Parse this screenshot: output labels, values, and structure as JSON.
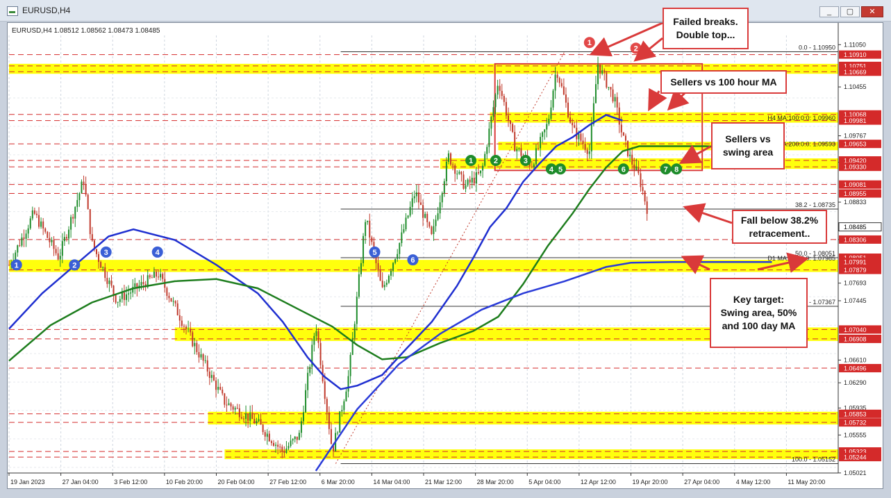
{
  "window": {
    "title": "EURUSD,H4",
    "min_label": "_",
    "max_label": "▢",
    "close_label": "✕"
  },
  "colors": {
    "bull": "#1e8c2b",
    "bear": "#c0392b",
    "ma100h": "#1f2fd0",
    "ma200h": "#1d7d1d",
    "ma100d": "#2a3bd8",
    "zone": "#ffff00",
    "levelLine": "#d42a2a",
    "tag": "#d42a2a",
    "greenMarker": "#1e8c2b",
    "blueMarker": "#3a5fd6",
    "redMarker": "#e24848",
    "annotation": "#d93a3a"
  },
  "chart_data": {
    "type": "candlestick",
    "symbol": "EURUSD",
    "timeframe": "H4",
    "info_line": "EURUSD,H4  1.08512 1.08562 1.08473 1.08485",
    "ylim": [
      1.0502,
      1.1118
    ],
    "current_price": "1.08485",
    "y_tick_labels": [
      "1.11050",
      "1.10455",
      "1.09767",
      "1.09395",
      "1.08833",
      "1.08306",
      "1.07693",
      "1.07445",
      "1.06610",
      "1.06290",
      "1.05935",
      "1.05555",
      "1.05021"
    ],
    "x_tick_labels": [
      "19 Jan 2023",
      "27 Jan 04:00",
      "3 Feb 12:00",
      "10 Feb 20:00",
      "20 Feb 04:00",
      "27 Feb 12:00",
      "6 Mar 20:00",
      "14 Mar 04:00",
      "21 Mar 12:00",
      "28 Mar 20:00",
      "5 Apr 04:00",
      "12 Apr 12:00",
      "19 Apr 20:00",
      "27 Apr 04:00",
      "4 May 12:00",
      "11 May 20:00"
    ],
    "price_tags": [
      {
        "label": "1.10910",
        "value": 1.1091
      },
      {
        "label": "1.10751",
        "value": 1.10751
      },
      {
        "label": "1.10669",
        "value": 1.10669
      },
      {
        "label": "1.10068",
        "value": 1.10068
      },
      {
        "label": "1.09981",
        "value": 1.09981
      },
      {
        "label": "1.09653",
        "value": 1.09653
      },
      {
        "label": "1.09420",
        "value": 1.0942
      },
      {
        "label": "1.09330",
        "value": 1.0933
      },
      {
        "label": "1.09081",
        "value": 1.09081
      },
      {
        "label": "1.08955",
        "value": 1.08955
      },
      {
        "label": "1.08485",
        "value": 1.08485
      },
      {
        "label": "1.08306",
        "value": 1.08306
      },
      {
        "label": "1.08051",
        "value": 1.08051
      },
      {
        "label": "1.07991",
        "value": 1.07991
      },
      {
        "label": "1.07879",
        "value": 1.07879
      },
      {
        "label": "1.07040",
        "value": 1.0704
      },
      {
        "label": "1.06908",
        "value": 1.06908
      },
      {
        "label": "1.06496",
        "value": 1.06496
      },
      {
        "label": "1.05853",
        "value": 1.05853
      },
      {
        "label": "1.05732",
        "value": 1.05732
      },
      {
        "label": "1.05323",
        "value": 1.05323
      },
      {
        "label": "1.05244",
        "value": 1.05244
      }
    ],
    "fib_levels": [
      {
        "label": "0.0 - 1.10950",
        "value": 1.1095
      },
      {
        "label": "38.2 - 1.08735",
        "value": 1.08735
      },
      {
        "label": "50.0 - 1.08051",
        "value": 1.08051
      },
      {
        "label": "61.8 - 1.07367",
        "value": 1.07367
      },
      {
        "label": "100.0 - 1.05152",
        "value": 1.05152
      }
    ],
    "ma_labels": [
      {
        "label": "H4 MA:100:0:0: 1.09960",
        "value": 1.0996
      },
      {
        "label": "H4 MA:200:0:0: 1.09593",
        "value": 1.09593
      },
      {
        "label": "D1 MA:100:0:0: 1.07985",
        "value": 1.07985
      }
    ],
    "zones": [
      {
        "top": 1.10751,
        "bottom": 1.10669
      },
      {
        "top": 1.10068,
        "bottom": 1.09981
      },
      {
        "top": 1.09653,
        "bottom": 1.09593
      },
      {
        "top": 1.0942,
        "bottom": 1.0933
      },
      {
        "top": 1.07991,
        "bottom": 1.07879
      },
      {
        "top": 1.0704,
        "bottom": 1.06908
      },
      {
        "top": 1.05853,
        "bottom": 1.05732
      },
      {
        "top": 1.05323,
        "bottom": 1.05244
      }
    ],
    "dashed_levels": [
      1.1091,
      1.10751,
      1.10669,
      1.10068,
      1.09981,
      1.09653,
      1.0942,
      1.0933,
      1.09081,
      1.08955,
      1.08306,
      1.07879,
      1.0704,
      1.06908,
      1.06496,
      1.05853,
      1.05732,
      1.05323,
      1.05244
    ],
    "ma100_h4": [
      [
        0,
        1.0705
      ],
      [
        0.04,
        1.0755
      ],
      [
        0.08,
        1.0795
      ],
      [
        0.12,
        1.0835
      ],
      [
        0.15,
        1.0845
      ],
      [
        0.2,
        1.083
      ],
      [
        0.25,
        1.0795
      ],
      [
        0.3,
        1.0755
      ],
      [
        0.33,
        1.0715
      ],
      [
        0.36,
        1.0665
      ],
      [
        0.38,
        1.0638
      ],
      [
        0.4,
        1.062
      ],
      [
        0.42,
        1.0625
      ],
      [
        0.45,
        1.064
      ],
      [
        0.48,
        1.0678
      ],
      [
        0.51,
        1.0715
      ],
      [
        0.54,
        1.0765
      ],
      [
        0.56,
        1.0805
      ],
      [
        0.58,
        1.0848
      ],
      [
        0.6,
        1.0875
      ],
      [
        0.62,
        1.0912
      ],
      [
        0.64,
        1.0938
      ],
      [
        0.66,
        1.0962
      ],
      [
        0.68,
        1.0975
      ],
      [
        0.7,
        1.0992
      ],
      [
        0.72,
        1.1006
      ],
      [
        0.73,
        1.1002
      ],
      [
        0.74,
        1.0998
      ]
    ],
    "ma200_h4": [
      [
        0,
        1.066
      ],
      [
        0.05,
        1.071
      ],
      [
        0.1,
        1.0742
      ],
      [
        0.15,
        1.0762
      ],
      [
        0.2,
        1.0772
      ],
      [
        0.25,
        1.0775
      ],
      [
        0.3,
        1.0762
      ],
      [
        0.35,
        1.0732
      ],
      [
        0.39,
        1.0708
      ],
      [
        0.42,
        1.0682
      ],
      [
        0.45,
        1.0662
      ],
      [
        0.48,
        1.0665
      ],
      [
        0.52,
        1.0685
      ],
      [
        0.56,
        1.0702
      ],
      [
        0.59,
        1.0722
      ],
      [
        0.62,
        1.0768
      ],
      [
        0.65,
        1.0822
      ],
      [
        0.68,
        1.0868
      ],
      [
        0.7,
        1.0902
      ],
      [
        0.72,
        1.0932
      ],
      [
        0.74,
        1.0955
      ],
      [
        0.76,
        1.0962
      ],
      [
        0.78,
        1.0962
      ],
      [
        0.8,
        1.0962
      ],
      [
        0.82,
        1.0962
      ],
      [
        0.84,
        1.0962
      ],
      [
        0.86,
        1.0961
      ],
      [
        0.88,
        1.0961
      ],
      [
        0.9,
        1.0961
      ],
      [
        0.92,
        1.096
      ]
    ],
    "ma100_d1": [
      [
        0.37,
        1.0505
      ],
      [
        0.42,
        1.0592
      ],
      [
        0.47,
        1.0655
      ],
      [
        0.52,
        1.0698
      ],
      [
        0.57,
        1.0732
      ],
      [
        0.62,
        1.0755
      ],
      [
        0.67,
        1.0772
      ],
      [
        0.72,
        1.0792
      ],
      [
        0.75,
        1.0798
      ],
      [
        0.8,
        1.0799
      ],
      [
        0.86,
        1.0799
      ],
      [
        0.92,
        1.0799
      ]
    ],
    "markers_blue": [
      "1",
      "2",
      "3",
      "4",
      "5",
      "6"
    ],
    "markers_green": [
      "1",
      "2",
      "3",
      "4",
      "5",
      "6",
      "7",
      "8"
    ],
    "markers_red": [
      "1",
      "2"
    ],
    "annotations": [
      {
        "id": "failed-breaks",
        "lines": [
          "Failed breaks.",
          "Double top..."
        ]
      },
      {
        "id": "sellers-100h",
        "lines": [
          "Sellers vs 100 hour MA"
        ]
      },
      {
        "id": "sellers-swing",
        "lines": [
          "Sellers vs",
          "swing area"
        ]
      },
      {
        "id": "fall-below",
        "lines": [
          "Fall below 38.2%",
          "retracement.."
        ]
      },
      {
        "id": "key-target",
        "lines": [
          "Key target:",
          "Swing area, 50%",
          "and 100 day MA"
        ]
      }
    ]
  }
}
